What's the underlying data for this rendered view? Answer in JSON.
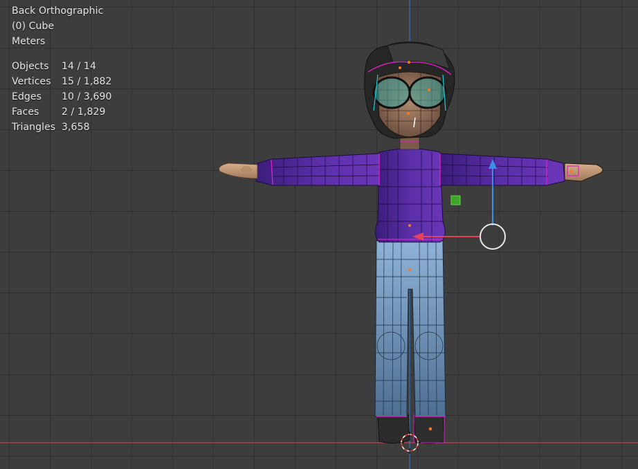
{
  "viewport": {
    "view_name": "Back Orthographic",
    "active_object": "(0) Cube",
    "units": "Meters",
    "statistics": [
      {
        "label": "Objects",
        "value": "14 / 14"
      },
      {
        "label": "Vertices",
        "value": "15 / 1,882"
      },
      {
        "label": "Edges",
        "value": "10 / 3,690"
      },
      {
        "label": "Faces",
        "value": "2 / 1,829"
      },
      {
        "label": "Triangles",
        "value": "3,658"
      }
    ]
  },
  "colors": {
    "background": "#3d3d3d",
    "x_axis": "#c8404f",
    "z_axis": "#2e72c0",
    "gizmo_x": "#e8405a",
    "gizmo_z": "#3b8fe8",
    "selection": "#e020c8",
    "shirt": "#5a2a9a",
    "jeans": "#7ea4cc",
    "skin": "#c9a07c",
    "hair": "#2a2a2a"
  },
  "icons": [
    "move-gizmo-icon",
    "3d-cursor-icon",
    "object-origin-icon"
  ]
}
